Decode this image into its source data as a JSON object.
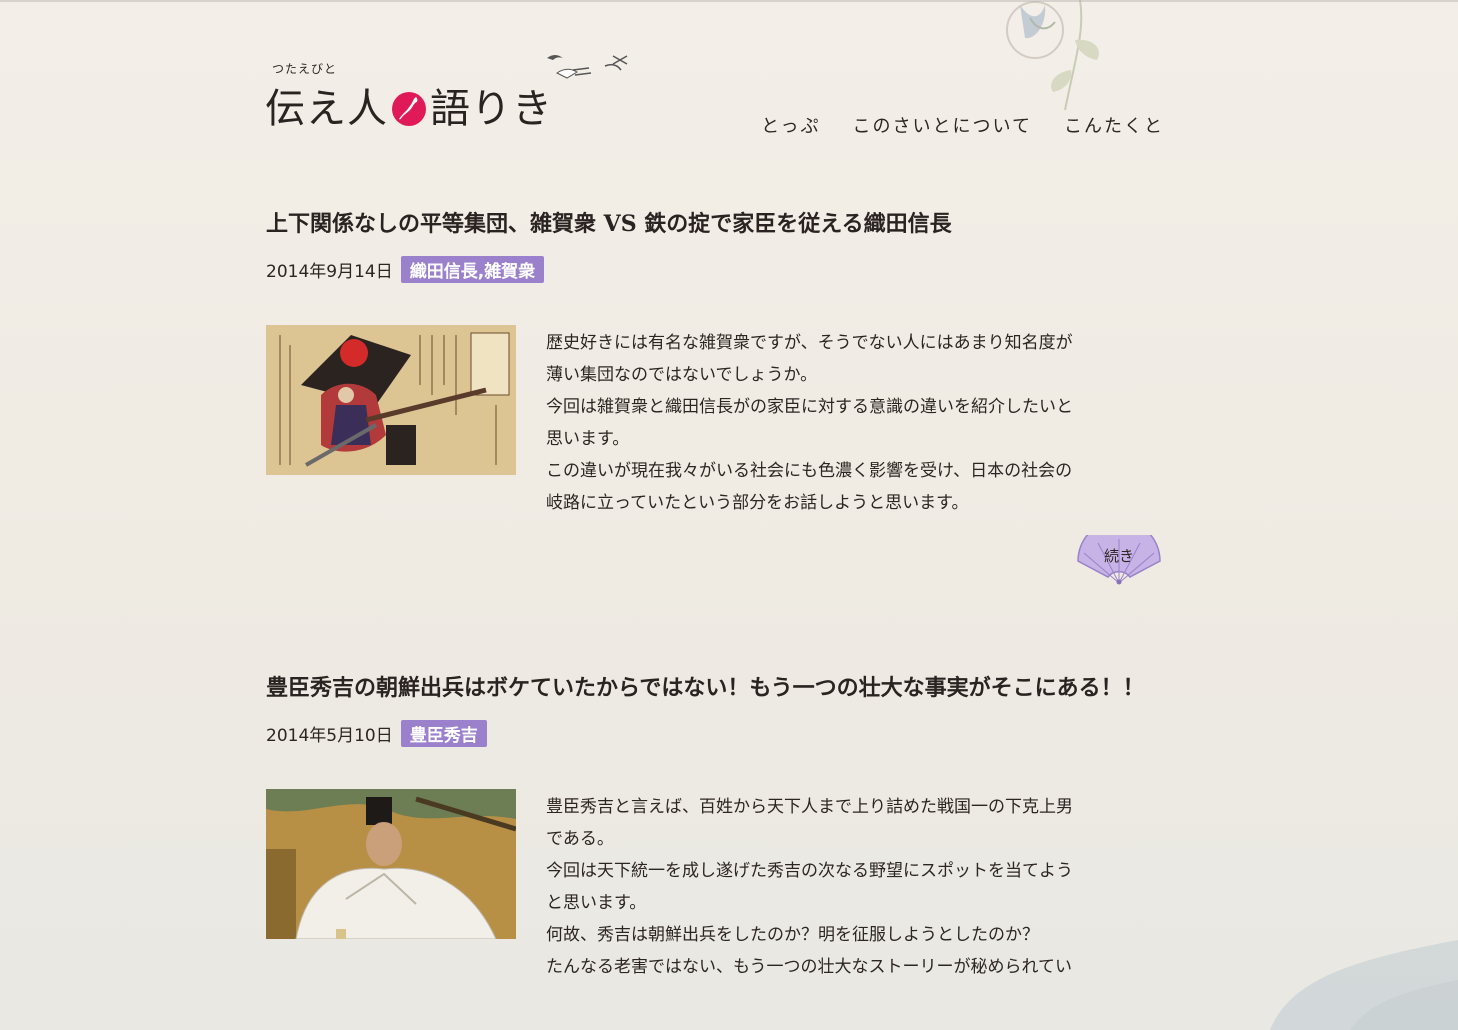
{
  "header": {
    "logo_ruby": "つたえびと",
    "logo_part1": "伝え人",
    "logo_part2": "語りき",
    "nav": [
      "とっぷ",
      "このさいとについて",
      "こんたくと"
    ]
  },
  "posts": [
    {
      "title": "上下関係なしの平等集団、雑賀衆 VS 鉄の掟で家臣を従える織田信長",
      "date": "2014年9月14日",
      "tags": [
        "織田信長",
        ",",
        "雑賀衆"
      ],
      "excerpt": [
        "歴史好きには有名な雑賀衆ですが、そうでない人にはあまり知名度が",
        "薄い集団なのではないでしょうか。",
        "今回は雑賀衆と織田信長がの家臣に対する意識の違いを紹介したいと",
        "思います。",
        "この違いが現在我々がいる社会にも色濃く影響を受け、日本の社会の",
        "岐路に立っていたという部分をお話しようと思います。"
      ],
      "more_label": "続き"
    },
    {
      "title": "豊臣秀吉の朝鮮出兵はボケていたからではない！もう一つの壮大な事実がそこにある！！",
      "date": "2014年5月10日",
      "tags": [
        "豊臣秀吉"
      ],
      "excerpt": [
        "豊臣秀吉と言えば、百姓から天下人まで上り詰めた戦国一の下克上男",
        "である。",
        "今回は天下統一を成し遂げた秀吉の次なる野望にスポットを当てよう",
        "と思います。",
        "何故、秀吉は朝鮮出兵をしたのか？明を征服しようとしたのか？",
        "たんなる老害ではない、もう一つの壮大なストーリーが秘められてい"
      ]
    }
  ],
  "colors": {
    "accent_purple": "#9b80cc",
    "logo_red": "#e01a58",
    "text": "#2d2522"
  }
}
